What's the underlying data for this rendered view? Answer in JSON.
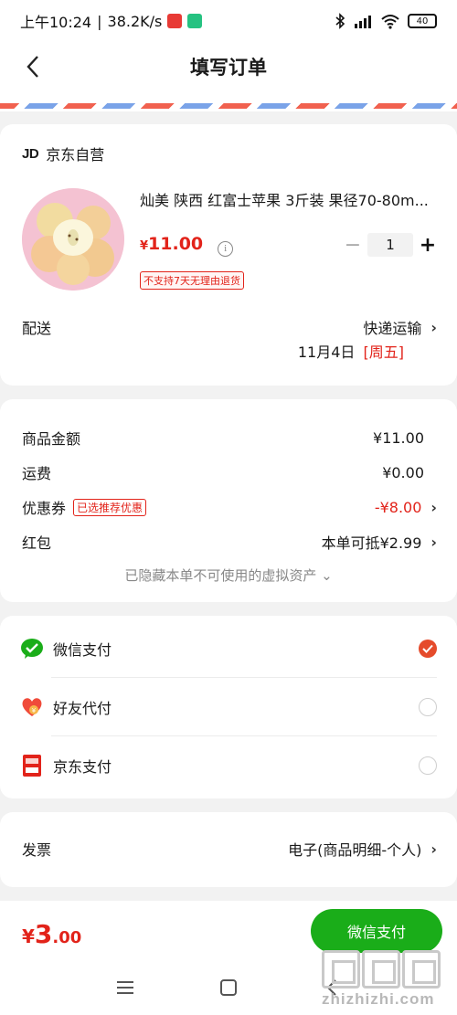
{
  "status_bar": {
    "time": "上午10:24",
    "speed": "38.2K/s",
    "battery": "40"
  },
  "header": {
    "title": "填写订单"
  },
  "shop": {
    "logo": "JD",
    "name": "京东自营"
  },
  "product": {
    "name": "灿美 陕西 红富士苹果 3斤装 果径70-80m...",
    "price_currency": "¥",
    "price_amount": "11.00",
    "quantity": "1",
    "return_policy": "不支持7天无理由退货"
  },
  "delivery": {
    "label": "配送",
    "method": "快递运输",
    "date": "11月4日",
    "weekday": "[周五]"
  },
  "price_summary": {
    "goods_label": "商品金额",
    "goods_value": "¥11.00",
    "shipping_label": "运费",
    "shipping_value": "¥0.00",
    "coupon_label": "优惠券",
    "coupon_tag": "已选推荐优惠",
    "coupon_value": "-¥8.00",
    "redpacket_label": "红包",
    "redpacket_value": "本单可抵¥2.99",
    "hidden_note": "已隐藏本单不可使用的虚拟资产 ⌄"
  },
  "payment": {
    "options": [
      {
        "label": "微信支付",
        "selected": true
      },
      {
        "label": "好友代付",
        "selected": false
      },
      {
        "label": "京东支付",
        "selected": false
      }
    ]
  },
  "invoice": {
    "label": "发票",
    "value": "电子(商品明细-个人)"
  },
  "bottom": {
    "currency": "¥",
    "total_int": "3",
    "total_dec": ".00",
    "pay_button": "微信支付"
  },
  "watermark": {
    "text": "zhizhizhi.com"
  },
  "colors": {
    "accent_red": "#e2231a",
    "wechat_green": "#1aad19",
    "radio_checked": "#e54b2b"
  }
}
